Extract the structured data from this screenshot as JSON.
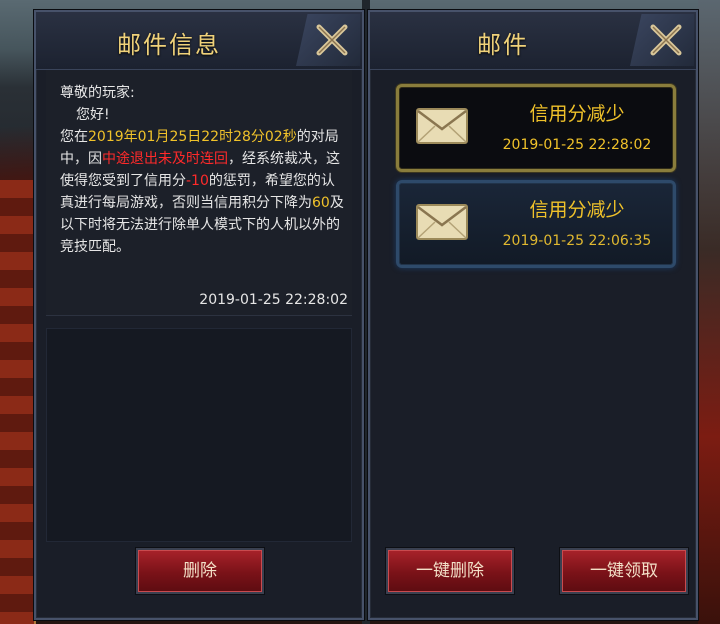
{
  "detail_panel": {
    "title": "邮件信息",
    "message": {
      "greeting": "尊敬的玩家:",
      "hello": "您好!",
      "p1": "您在",
      "time_hl": "2019年01月25日22时28分02秒",
      "p2": "的对局中，因",
      "reason_hl": "中途退出未及时连回",
      "p3": "，经系统裁决，这使得您受到了信用分",
      "penalty_hl": "-10",
      "p4": "的惩罚，希望您的认真进行每局游戏，否则当信用积分下降为",
      "threshold_hl": "60",
      "p5": "及以下时将无法进行除单人模式下的人机以外的竞技匹配。"
    },
    "date": "2019-01-25 22:28:02",
    "delete_label": "删除"
  },
  "list_panel": {
    "title": "邮件",
    "mails": [
      {
        "title": "信用分减少",
        "time": "2019-01-25 22:28:02",
        "selected": true
      },
      {
        "title": "信用分减少",
        "time": "2019-01-25 22:06:35",
        "selected": false
      }
    ],
    "delete_all_label": "一键删除",
    "claim_all_label": "一键领取"
  },
  "colors": {
    "title_gold": "#f0d27a",
    "highlight_gold": "#f0c22a",
    "highlight_red": "#ff2a2a",
    "button_red": "#8a1820"
  },
  "icons": [
    "close-icon",
    "envelope-icon"
  ]
}
